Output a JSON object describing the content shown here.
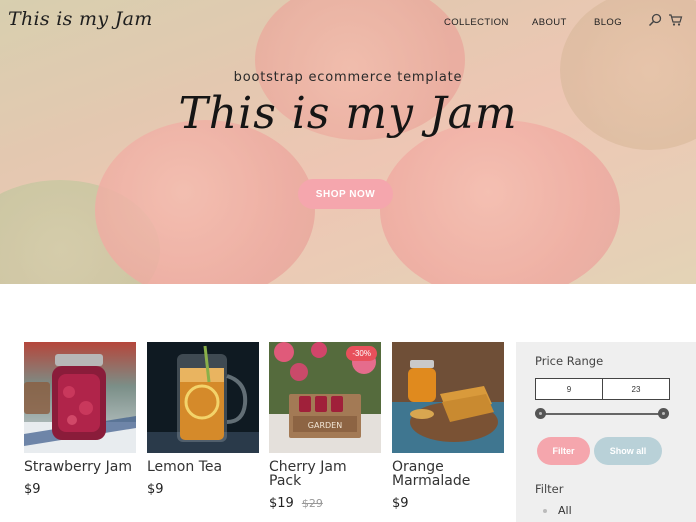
{
  "brand": {
    "logo": "This is my Jam"
  },
  "nav": {
    "collection": "COLLECTION",
    "about": "ABOUT",
    "blog": "BLOG"
  },
  "icons": {
    "search": "search-icon",
    "cart": "cart-icon"
  },
  "hero": {
    "subtitle": "bootstrap ecommerce template",
    "title": "This is my Jam",
    "cta": "SHOP NOW"
  },
  "products": [
    {
      "name": "Strawberry Jam",
      "price": "$9"
    },
    {
      "name": "Lemon Tea",
      "price": "$9"
    },
    {
      "name": "Cherry Jam Pack",
      "price": "$19",
      "old_price": "$29",
      "badge": "-30%",
      "crate_label": "GARDEN"
    },
    {
      "name": "Orange Marmalade",
      "price": "$9"
    }
  ],
  "sidebar": {
    "price_range_title": "Price Range",
    "min": "9",
    "max": "23",
    "filter_button": "Filter",
    "show_all_button": "Show all",
    "filter_title": "Filter",
    "filter_items": [
      "All"
    ]
  },
  "colors": {
    "accent_pink": "#f5a6ad",
    "secondary_blue": "#b9d1d8",
    "badge_red": "#e8505b",
    "sidebar_bg": "#efefef"
  }
}
